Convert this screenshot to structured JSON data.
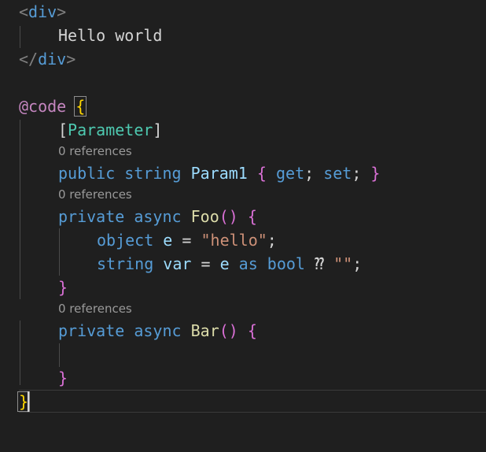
{
  "editor": {
    "language": "razor",
    "lines": {
      "div_open": {
        "lt": "<",
        "tag": "div",
        "gt": ">"
      },
      "hello": {
        "text": "Hello world"
      },
      "div_close": {
        "lt": "</",
        "tag": "div",
        "gt": ">"
      },
      "code_block": {
        "directive": "@code",
        "brace": "{"
      },
      "attribute": {
        "open": "[",
        "name": "Parameter",
        "close": "]"
      },
      "lens1": {
        "text": "0 references"
      },
      "property": {
        "kw1": "public",
        "kw2": "string",
        "name": "Param1",
        "open": "{",
        "get": "get",
        "semi1": ";",
        "set": "set",
        "semi2": ";",
        "close": "}"
      },
      "lens2": {
        "text": "0 references"
      },
      "foo_decl": {
        "kw1": "private",
        "kw2": "async",
        "name": "Foo",
        "parens": "()",
        "brace": "{"
      },
      "obj_line": {
        "kw": "object",
        "var": "e",
        "op": "=",
        "str": "\"hello\"",
        "semi": ";"
      },
      "str_line": {
        "kw": "string",
        "var": "var",
        "op": "=",
        "var2": "e",
        "as": "as",
        "type": "bool",
        "coalesce": "⁇",
        "str": "\"\"",
        "semi": ";"
      },
      "foo_close": {
        "brace": "}"
      },
      "lens3": {
        "text": "0 references"
      },
      "bar_decl": {
        "kw1": "private",
        "kw2": "async",
        "name": "Bar",
        "parens": "()",
        "brace": "{"
      },
      "bar_close": {
        "brace": "}"
      },
      "code_close": {
        "brace": "}"
      }
    }
  }
}
